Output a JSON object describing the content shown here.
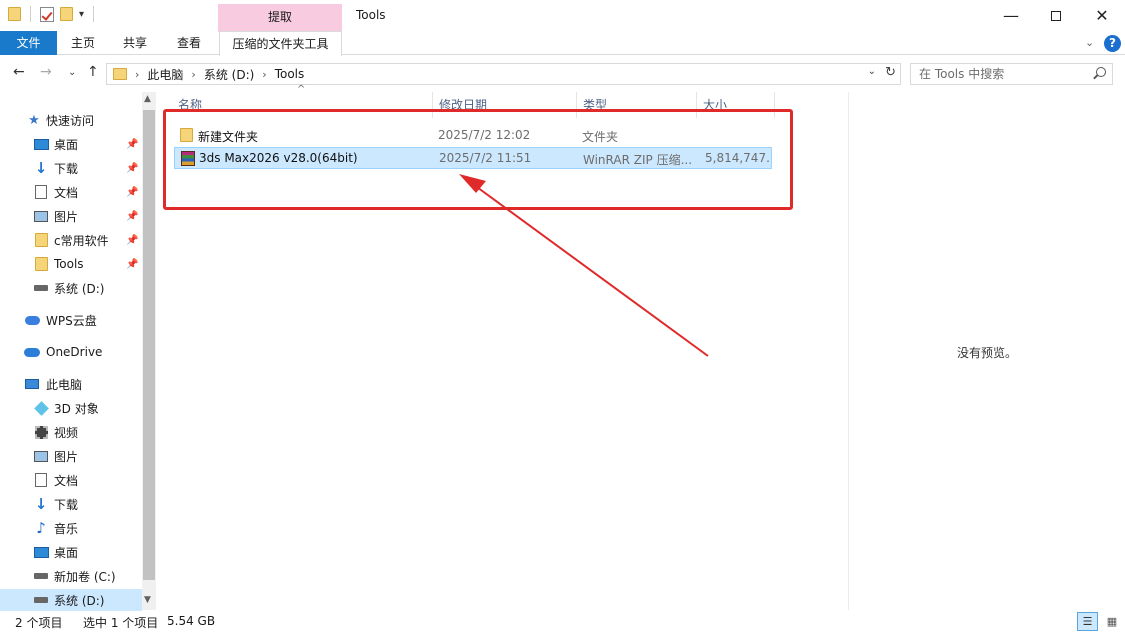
{
  "window": {
    "title": "Tools",
    "context_tab_top": "提取",
    "minimize": "—",
    "maximize": "",
    "close": "✕"
  },
  "ribbon": {
    "tabs": [
      "文件",
      "主页",
      "共享",
      "查看",
      "压缩的文件夹工具"
    ],
    "help": "?",
    "accent": "#1979ca",
    "context_color": "#f9cbe0"
  },
  "address": {
    "crumbs": [
      "此电脑",
      "系统 (D:)",
      "Tools"
    ],
    "search_placeholder": "在 Tools 中搜索"
  },
  "nav": {
    "quick_access": "快速访问",
    "items": [
      {
        "label": "桌面",
        "icon": "desktop-icon",
        "pinned": true
      },
      {
        "label": "下载",
        "icon": "download-icon",
        "pinned": true
      },
      {
        "label": "文档",
        "icon": "document-icon",
        "pinned": true
      },
      {
        "label": "图片",
        "icon": "pictures-icon",
        "pinned": true
      },
      {
        "label": "c常用软件",
        "icon": "folder-icon",
        "pinned": true
      },
      {
        "label": "Tools",
        "icon": "folder-icon",
        "pinned": true
      },
      {
        "label": "系统 (D:)",
        "icon": "drive-icon",
        "pinned": false
      }
    ],
    "wps": "WPS云盘",
    "onedrive": "OneDrive",
    "this_pc": "此电脑",
    "pc_items": [
      {
        "label": "3D 对象",
        "icon": "3d-objects-icon"
      },
      {
        "label": "视频",
        "icon": "videos-icon"
      },
      {
        "label": "图片",
        "icon": "pictures-icon"
      },
      {
        "label": "文档",
        "icon": "document-icon"
      },
      {
        "label": "下载",
        "icon": "download-icon"
      },
      {
        "label": "音乐",
        "icon": "music-icon"
      },
      {
        "label": "桌面",
        "icon": "desktop-icon"
      },
      {
        "label": "新加卷 (C:)",
        "icon": "drive-icon"
      },
      {
        "label": "系统 (D:)",
        "icon": "drive-icon"
      }
    ]
  },
  "columns": [
    "名称",
    "修改日期",
    "类型",
    "大小"
  ],
  "files": [
    {
      "name": "新建文件夹",
      "date": "2025/7/2 12:02",
      "type": "文件夹",
      "size": "",
      "icon": "folder-icon",
      "selected": false
    },
    {
      "name": "3ds Max2026 v28.0(64bit)",
      "date": "2025/7/2 11:51",
      "type": "WinRAR ZIP 压缩...",
      "size": "5,814,747...",
      "icon": "winrar-icon",
      "selected": true
    }
  ],
  "preview": {
    "message": "没有预览。"
  },
  "status": {
    "count": "2 个项目",
    "selected": "选中 1 个项目",
    "size": "5.54 GB"
  },
  "annotation_color": "#e02a2a"
}
